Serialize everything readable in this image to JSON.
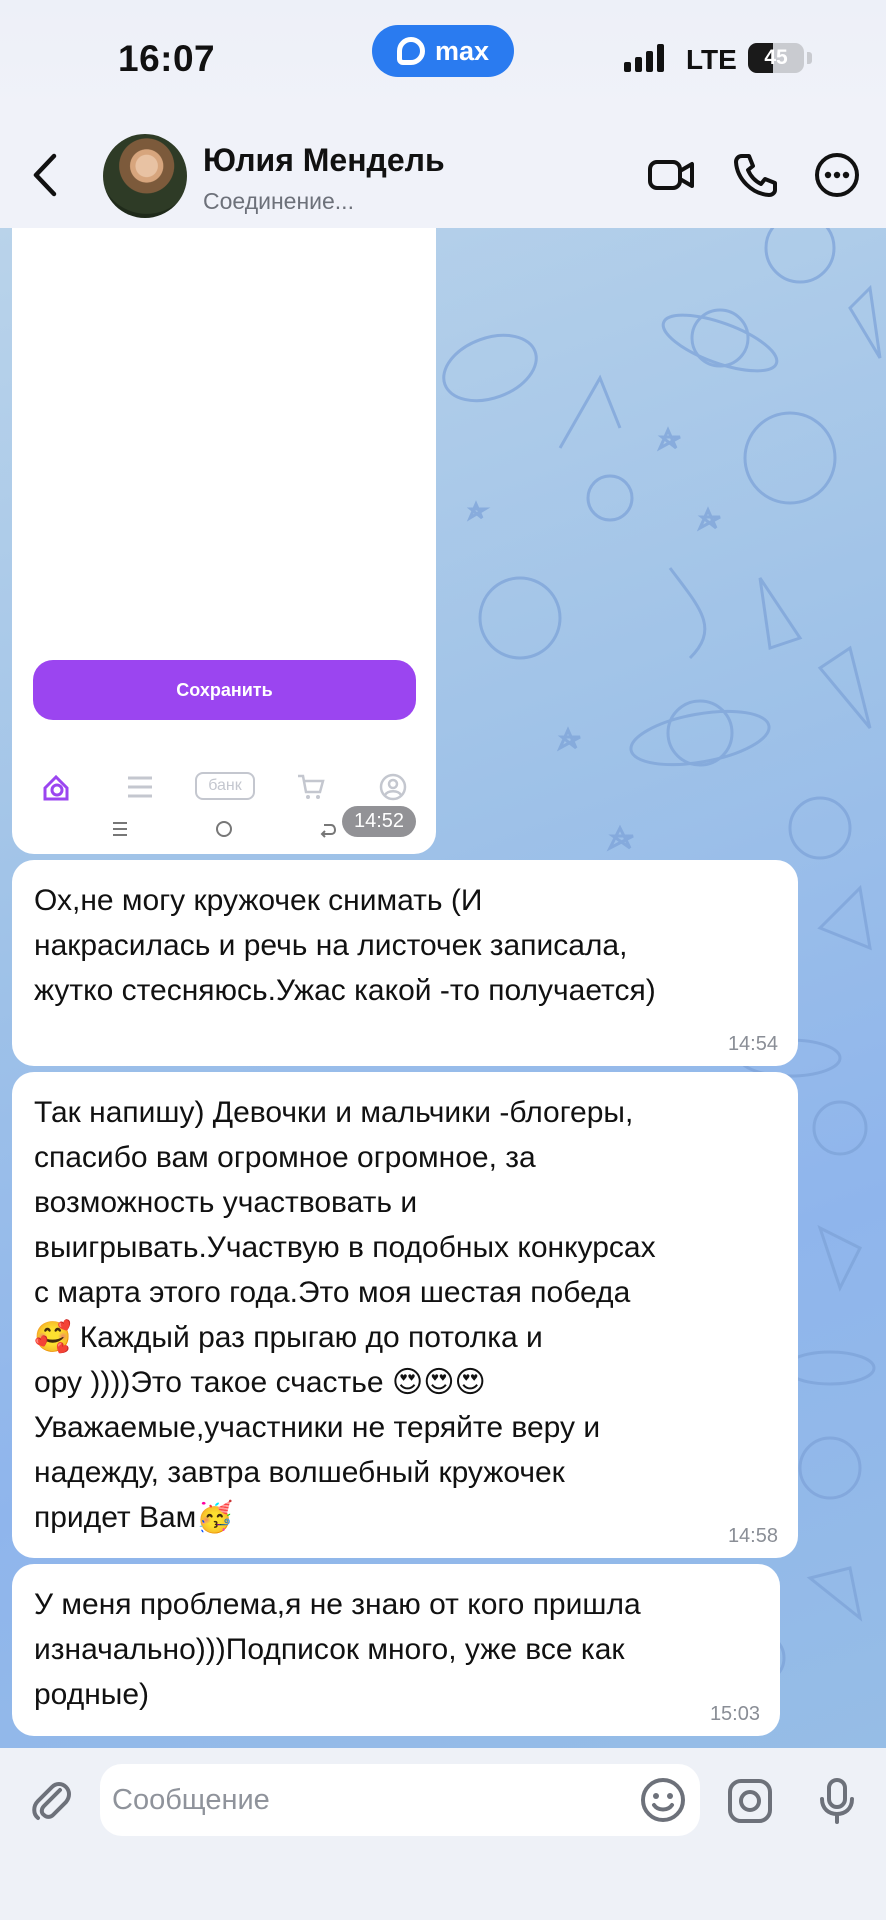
{
  "status_bar": {
    "time": "16:07",
    "app_badge": "max",
    "network": "LTE",
    "battery_level": "45",
    "battery_fraction": 0.45
  },
  "header": {
    "contact_name": "Юлия Мендель",
    "contact_status": "Соединение..."
  },
  "messages": [
    {
      "type": "image",
      "time": "14:52",
      "screenshot_button": "Сохранить",
      "screenshot_tab": "банк"
    },
    {
      "type": "text",
      "text": "Ох,не могу кружочек снимать (И\nнакрасилась и речь на листочек записала,\nжутко стесняюсь.Ужас какой -то получается)",
      "time": "14:54"
    },
    {
      "type": "text",
      "text": "Так напишу) Девочки и мальчики -блогеры,\nспасибо вам огромное огромное, за\nвозможность участвовать и\nвыигрывать.Участвую в подобных конкурсах\nс марта этого года.Это моя шестая победа\n🥰 Каждый раз прыгаю до потолка и\nору ))))Это такое счастье 😍😍😍\nУважаемые,участники не теряйте веру и\nнадежду, завтра волшебный кружочек\nпридет Вам🥳",
      "time": "14:58"
    },
    {
      "type": "text",
      "text": "У меня проблема,я не знаю от кого пришла\nизначально)))Подписок много, уже все как\nродные)",
      "time": "15:03"
    }
  ],
  "input": {
    "placeholder": "Сообщение"
  },
  "colors": {
    "accent_blue": "#2a7bf0",
    "save_purple": "#9b45f0",
    "bubble_bg": "#ffffff"
  },
  "icons": [
    "back-icon",
    "video-call-icon",
    "phone-icon",
    "more-icon",
    "attach-icon",
    "emoji-icon",
    "camera-icon",
    "microphone-icon"
  ]
}
